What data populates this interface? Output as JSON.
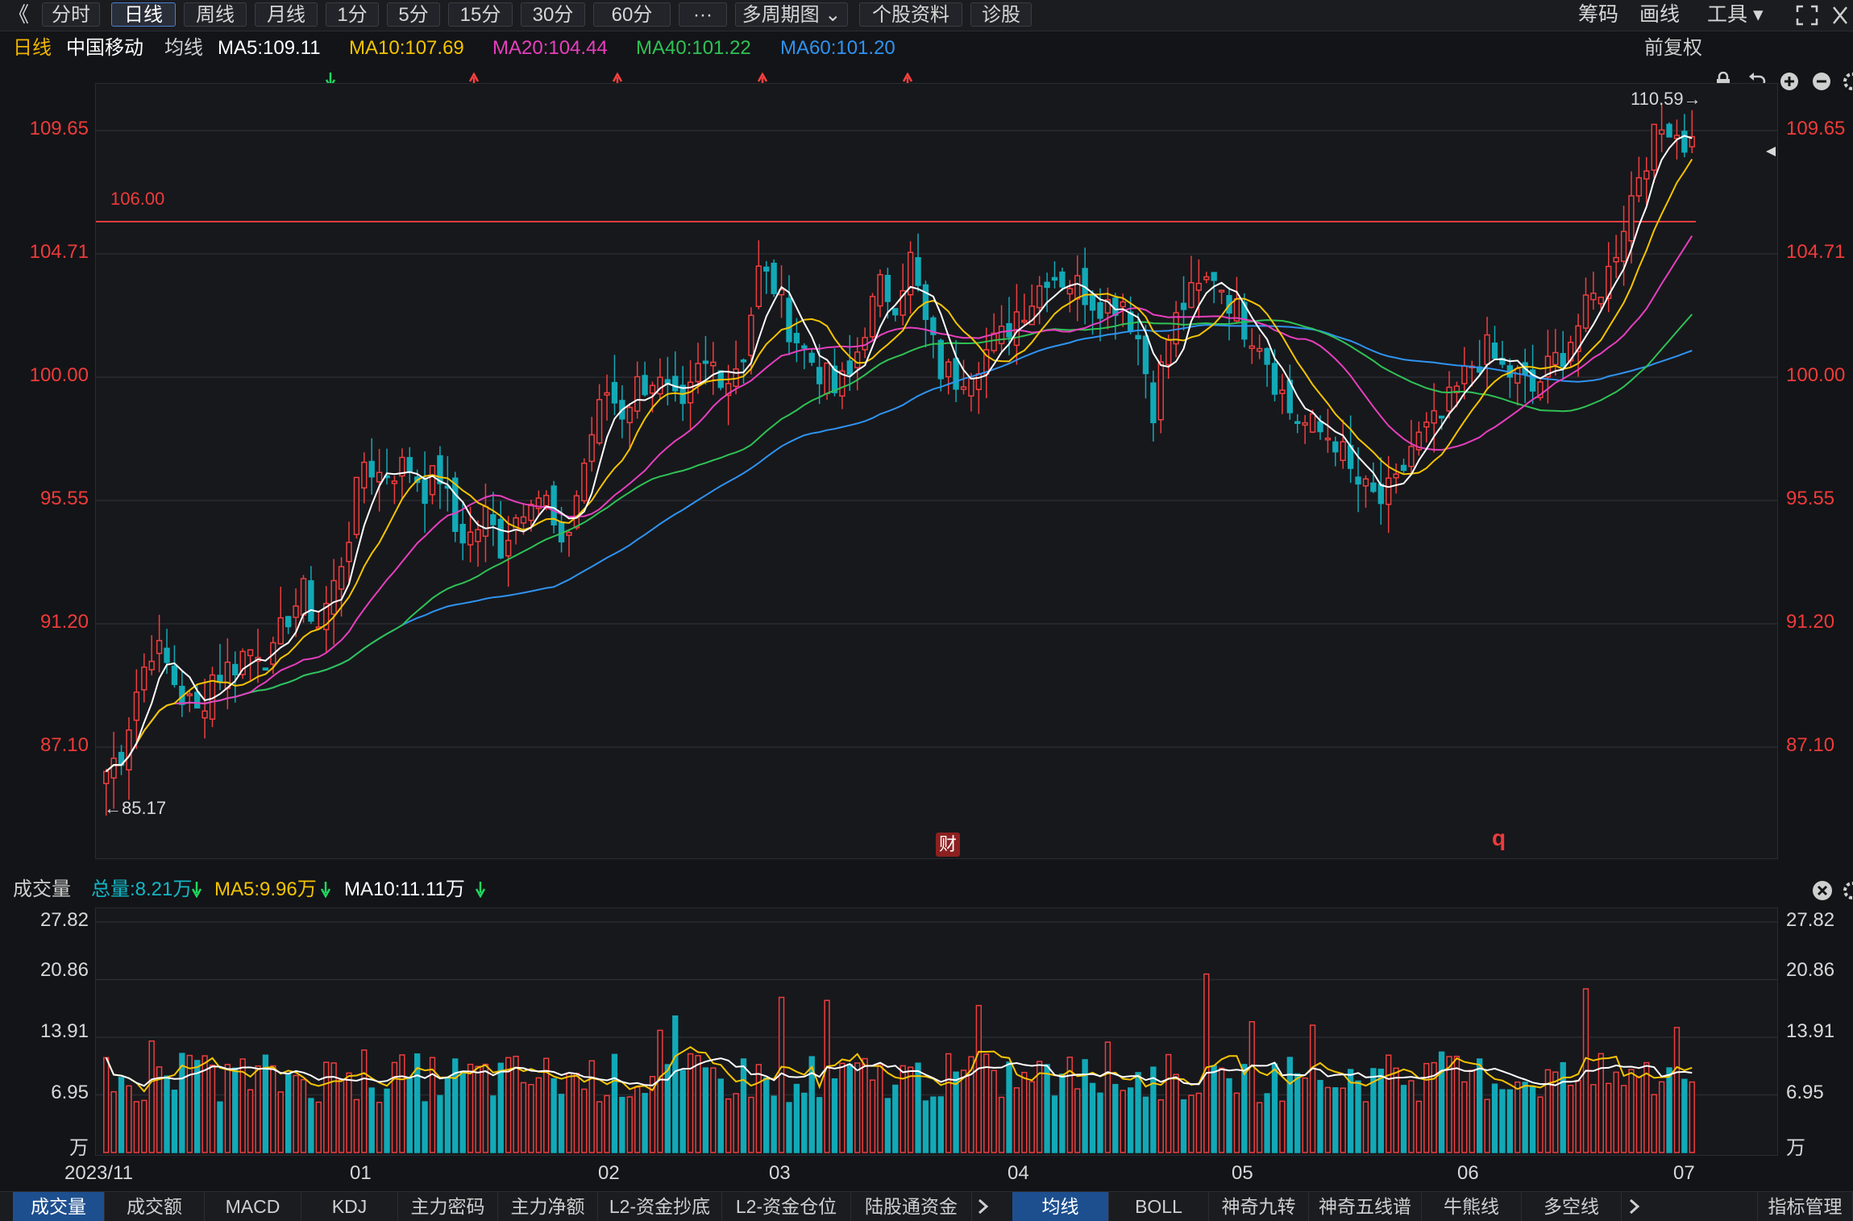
{
  "toolbar": {
    "back_glyph": "《",
    "buttons": [
      "分时",
      "日线",
      "周线",
      "月线",
      "1分",
      "5分",
      "15分",
      "30分",
      "60分",
      "···",
      "多周期图 ⌄",
      "个股资料",
      "诊股"
    ],
    "active": "日线",
    "right": [
      "筹码",
      "画线",
      "工具 ▾"
    ],
    "right_icons": [
      "expand-icon",
      "close-icon"
    ]
  },
  "legend": {
    "period": "日线",
    "stock": "中国移动",
    "ma_label": "均线",
    "ma5": "MA5:109.11",
    "ma10": "MA10:107.69",
    "ma20": "MA20:104.44",
    "ma40": "MA40:101.22",
    "ma60": "MA60:101.20",
    "ma5_dir": "down",
    "ma10_dir": "up",
    "ma20_dir": "up",
    "ma40_dir": "up",
    "ma60_dir": "up",
    "right": "前复权"
  },
  "colors": {
    "up": "#ee3e3e",
    "down": "#12a9b7",
    "ma5": "#ffffff",
    "ma10": "#f5c400",
    "ma20": "#e63fbe",
    "ma40": "#2fc255",
    "ma60": "#2f93f0",
    "axis_text": "#ee3b3b"
  },
  "main_chart": {
    "y_ticks": [
      "109.65",
      "104.71",
      "100.00",
      "95.55",
      "91.20",
      "87.10"
    ],
    "hline_label": "106.00",
    "high_label": "110.59→",
    "low_label": "←85.17",
    "fin_marker": "财",
    "q_marker": "q"
  },
  "volume": {
    "title": "成交量",
    "total": "总量:8.21万",
    "ma5": "MA5:9.96万",
    "ma10": "MA10:11.11万",
    "y_ticks": [
      "27.82",
      "20.86",
      "13.91",
      "6.95"
    ],
    "unit": "万"
  },
  "x_axis": [
    "2023/11",
    "01",
    "02",
    "03",
    "04",
    "05",
    "06",
    "07"
  ],
  "bottom_tabs_left": [
    "成交量",
    "成交额",
    "MACD",
    "KDJ",
    "主力密码",
    "主力净额",
    "L2-资金抄底",
    "L2-资金仓位",
    "陆股通资金"
  ],
  "bottom_tabs_right": [
    "均线",
    "BOLL",
    "神奇九转",
    "神奇五线谱",
    "牛熊线",
    "多空线"
  ],
  "bottom_right": "指标管理",
  "chart_data": {
    "type": "candlestick",
    "y_range": [
      84.5,
      111.5
    ],
    "guide_line": 106.0,
    "close_trend": [
      [
        0,
        86.3
      ],
      [
        2,
        87.0
      ],
      [
        4,
        89.0
      ],
      [
        6,
        90.5
      ],
      [
        8,
        89.8
      ],
      [
        10,
        88.8
      ],
      [
        12,
        88.2
      ],
      [
        14,
        89.5
      ],
      [
        16,
        89.7
      ],
      [
        18,
        90.2
      ],
      [
        20,
        90.5
      ],
      [
        22,
        90.0
      ],
      [
        24,
        91.6
      ],
      [
        26,
        92.2
      ],
      [
        28,
        91.2
      ],
      [
        30,
        92.5
      ],
      [
        32,
        94.5
      ],
      [
        34,
        97.0
      ],
      [
        36,
        96.5
      ],
      [
        38,
        96.7
      ],
      [
        40,
        96.8
      ],
      [
        42,
        96.0
      ],
      [
        44,
        96.5
      ],
      [
        46,
        94.5
      ],
      [
        48,
        94.3
      ],
      [
        50,
        95.0
      ],
      [
        52,
        94.0
      ],
      [
        54,
        95.0
      ],
      [
        56,
        96.0
      ],
      [
        58,
        95.5
      ],
      [
        60,
        93.5
      ],
      [
        62,
        95.8
      ],
      [
        64,
        98.0
      ],
      [
        66,
        99.5
      ],
      [
        68,
        98.8
      ],
      [
        70,
        99.7
      ],
      [
        72,
        100.0
      ],
      [
        74,
        99.3
      ],
      [
        76,
        98.5
      ],
      [
        78,
        100.2
      ],
      [
        80,
        100.5
      ],
      [
        82,
        100.0
      ],
      [
        84,
        101.0
      ],
      [
        86,
        104.0
      ],
      [
        88,
        103.5
      ],
      [
        90,
        102.0
      ],
      [
        92,
        101.0
      ],
      [
        94,
        100.3
      ],
      [
        96,
        99.5
      ],
      [
        98,
        100.0
      ],
      [
        100,
        102.0
      ],
      [
        102,
        103.4
      ],
      [
        104,
        103.0
      ],
      [
        106,
        104.5
      ],
      [
        108,
        102.0
      ],
      [
        110,
        100.3
      ],
      [
        112,
        100.0
      ],
      [
        114,
        100.5
      ],
      [
        116,
        101.0
      ],
      [
        118,
        101.5
      ],
      [
        120,
        102.5
      ],
      [
        122,
        103.0
      ],
      [
        124,
        104.0
      ],
      [
        126,
        103.8
      ],
      [
        128,
        103.5
      ],
      [
        130,
        103.0
      ],
      [
        132,
        102.8
      ],
      [
        134,
        103.0
      ],
      [
        136,
        101.5
      ],
      [
        138,
        99.0
      ],
      [
        140,
        101.5
      ],
      [
        142,
        102.8
      ],
      [
        144,
        103.3
      ],
      [
        146,
        104.0
      ],
      [
        148,
        103.0
      ],
      [
        150,
        102.0
      ],
      [
        152,
        101.5
      ],
      [
        154,
        100.0
      ],
      [
        156,
        98.8
      ],
      [
        158,
        98.3
      ],
      [
        160,
        98.0
      ],
      [
        162,
        97.8
      ],
      [
        164,
        96.5
      ],
      [
        166,
        95.8
      ],
      [
        168,
        95.5
      ],
      [
        170,
        96.0
      ],
      [
        172,
        97.5
      ],
      [
        174,
        98.0
      ],
      [
        176,
        98.5
      ],
      [
        178,
        99.5
      ],
      [
        180,
        100.5
      ],
      [
        182,
        101.0
      ],
      [
        184,
        100.3
      ],
      [
        186,
        100.0
      ],
      [
        188,
        99.5
      ],
      [
        190,
        100.3
      ],
      [
        192,
        101.0
      ],
      [
        194,
        102.0
      ],
      [
        196,
        103.0
      ],
      [
        198,
        104.0
      ],
      [
        200,
        106.0
      ],
      [
        202,
        108.0
      ],
      [
        204,
        109.3
      ],
      [
        206,
        110.0
      ],
      [
        208,
        109.2
      ]
    ],
    "ma_series": [
      {
        "name": "MA5",
        "value": 109.11
      },
      {
        "name": "MA10",
        "value": 107.69
      },
      {
        "name": "MA20",
        "value": 104.44
      },
      {
        "name": "MA40",
        "value": 101.22
      },
      {
        "name": "MA60",
        "value": 101.2
      }
    ],
    "volume_range": [
      0,
      27.82
    ]
  }
}
